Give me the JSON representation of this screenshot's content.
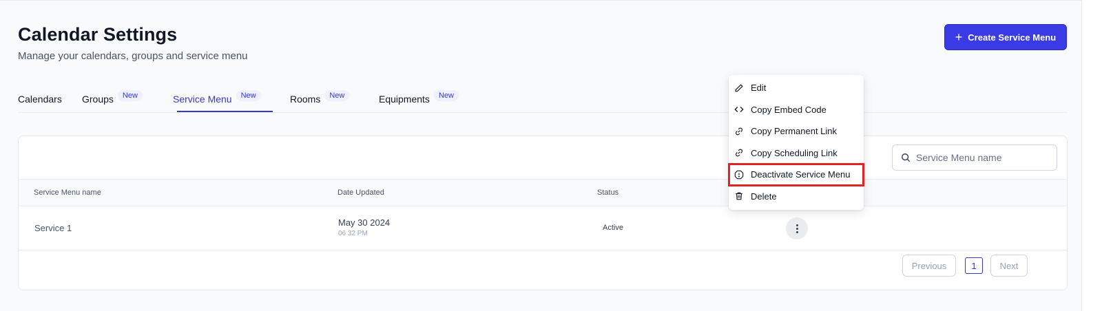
{
  "header": {
    "title": "Calendar Settings",
    "subtitle": "Manage your calendars, groups and service menu",
    "create_button": "Create Service Menu"
  },
  "tabs": [
    {
      "label": "Calendars",
      "badge": null,
      "active": false
    },
    {
      "label": "Groups",
      "badge": "New",
      "active": false
    },
    {
      "label": "Service Menu",
      "badge": "New",
      "active": true
    },
    {
      "label": "Rooms",
      "badge": "New",
      "active": false
    },
    {
      "label": "Equipments",
      "badge": "New",
      "active": false
    }
  ],
  "search": {
    "placeholder": "Service Menu name",
    "value": ""
  },
  "table": {
    "columns": [
      "Service Menu name",
      "Date Updated",
      "Status"
    ],
    "rows": [
      {
        "name": "Service 1",
        "date": "May 30 2024",
        "time": "06 32 PM",
        "status": "Active"
      }
    ]
  },
  "pagination": {
    "previous": "Previous",
    "page": "1",
    "next": "Next"
  },
  "context_menu": {
    "items": [
      {
        "label": "Edit",
        "icon": "pencil-icon"
      },
      {
        "label": "Copy Embed Code",
        "icon": "code-icon"
      },
      {
        "label": "Copy Permanent Link",
        "icon": "link-icon"
      },
      {
        "label": "Copy Scheduling Link",
        "icon": "link-icon"
      },
      {
        "label": "Deactivate Service Menu",
        "icon": "alert-hexagon-icon",
        "highlighted": true
      },
      {
        "label": "Delete",
        "icon": "trash-icon"
      }
    ]
  },
  "colors": {
    "accent": "#3b3be6",
    "highlight_border": "#e02424"
  }
}
